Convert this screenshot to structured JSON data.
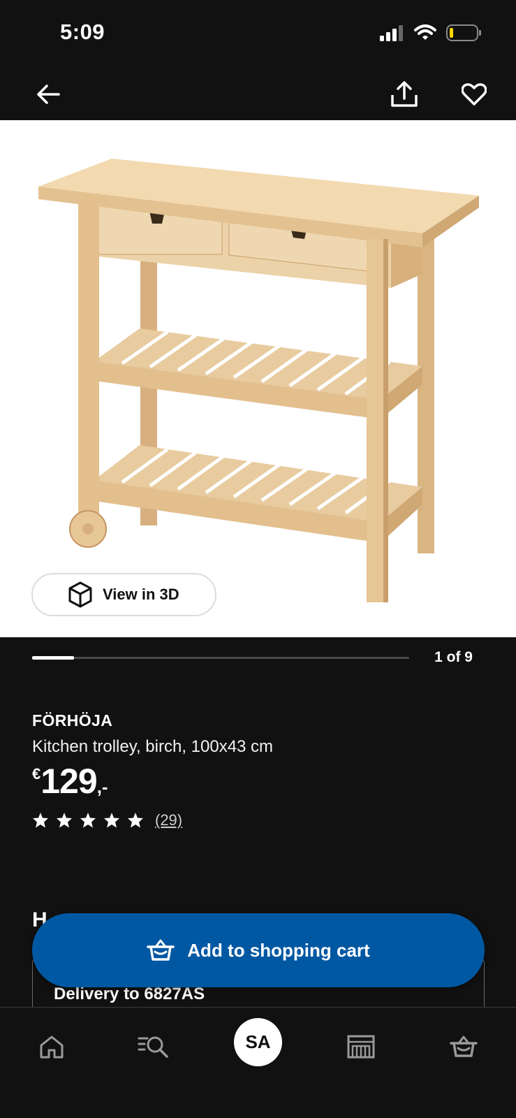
{
  "status_bar": {
    "time": "5:09",
    "icons": [
      "signal-icon",
      "wifi-icon",
      "battery-icon"
    ],
    "battery_color": "#ffd600"
  },
  "top_nav": {
    "icons": [
      "back-arrow-icon",
      "share-icon",
      "heart-icon"
    ]
  },
  "media": {
    "view_3d_label": "View in 3D",
    "view_3d_icon": "cube-icon",
    "carousel_counter": "1 of 9",
    "carousel_progress": 0.111
  },
  "product": {
    "name": "FÖRHÖJA",
    "description": "Kitchen trolley, birch, 100x43 cm",
    "price_currency": "€",
    "price_value": "129",
    "price_suffix": ",-",
    "rating_stars": 5,
    "review_count": "(29)"
  },
  "sections": {
    "heading_peek": "H",
    "delivery_label": "Delivery to 6827AS"
  },
  "cta": {
    "add_to_cart_label": "Add to shopping cart",
    "icon": "basket-icon",
    "color": "#0058a3"
  },
  "bottom_nav": {
    "profile_initials": "SA",
    "icons": [
      "home-icon",
      "search-list-icon",
      "profile-avatar",
      "store-icon",
      "basket-icon"
    ]
  }
}
